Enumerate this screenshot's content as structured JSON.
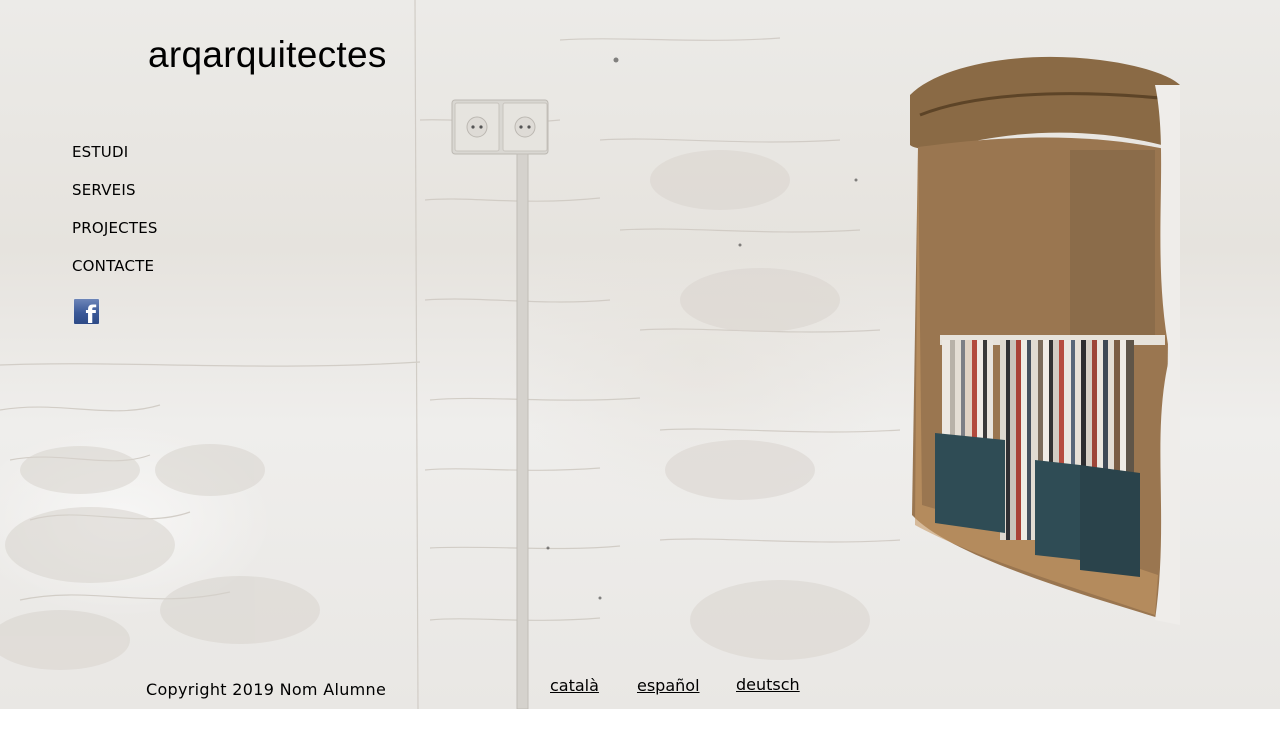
{
  "site": {
    "brand": "arqarquitectes"
  },
  "nav": {
    "items": [
      "ESTUDI",
      "SERVEIS",
      "PROJECTES",
      "CONTACTE"
    ]
  },
  "social": {
    "facebook_icon": "facebook-icon",
    "facebook_glyph": "f",
    "facebook_color": "#3b5998"
  },
  "footer": {
    "copyright": "Copyright 2019 Nom Alumne",
    "languages": [
      "català",
      "español",
      "deutsch"
    ]
  }
}
